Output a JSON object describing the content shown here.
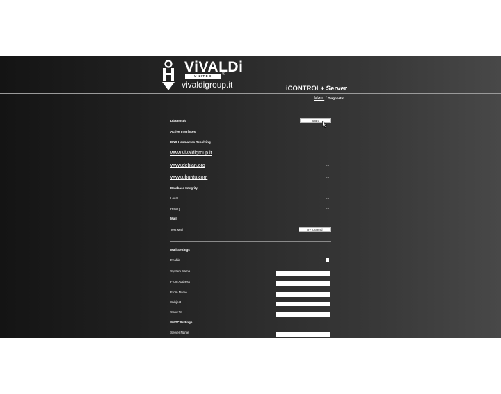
{
  "header": {
    "brand_name": "ViVALDi",
    "brand_reg": "®",
    "brand_sub": "UNITED GROUP",
    "brand_url": "vivaldigroup.it",
    "server_title": "iCONTROL+ Server"
  },
  "breadcrumb": {
    "main": "Main",
    "separator": "/",
    "current": "Diagnostic"
  },
  "diagnostic": {
    "label": "Diagnostic",
    "start_button": "Start"
  },
  "active_interfaces": {
    "label": "Active Interfaces"
  },
  "dns": {
    "label": "DNS Hostnames Resolving",
    "hosts": [
      {
        "name": "www.vivaldigroup.it",
        "status": "..."
      },
      {
        "name": "www.debian.org",
        "status": "..."
      },
      {
        "name": "www.ubuntu.com",
        "status": "..."
      }
    ]
  },
  "database": {
    "label": "Database Integrity",
    "local": {
      "label": "Local",
      "status": "..."
    },
    "history": {
      "label": "History",
      "status": "..."
    }
  },
  "mail": {
    "label": "Mail",
    "test_label": "Test Mail",
    "try_button": "Try to Send"
  },
  "mail_settings": {
    "label": "Mail Settings",
    "enable_label": "Enable",
    "system_name": {
      "label": "System Name",
      "value": ""
    },
    "from_address": {
      "label": "From Address",
      "value": ""
    },
    "from_name": {
      "label": "From Name",
      "value": ""
    },
    "subject": {
      "label": "Subject",
      "value": ""
    },
    "send_to": {
      "label": "Send To",
      "value": ""
    }
  },
  "smtp_settings": {
    "label": "SMTP Settings",
    "server_name": {
      "label": "Server Name",
      "value": ""
    }
  }
}
